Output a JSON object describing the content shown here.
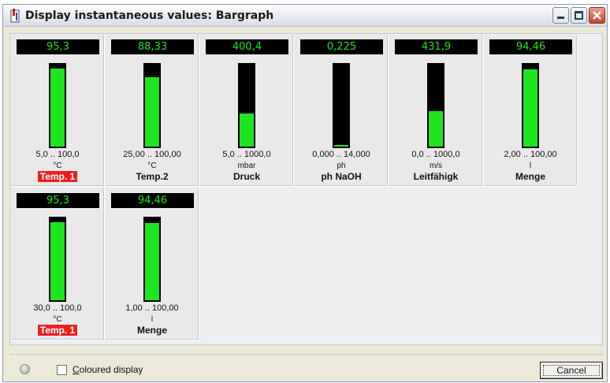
{
  "window": {
    "title": "Display instantaneous values: Bargraph"
  },
  "channels": [
    {
      "value": "95,3",
      "range": "5,0 .. 100,0",
      "unit": "°C",
      "name": "Temp. 1",
      "alarm": true,
      "level": 0.95
    },
    {
      "value": "88,33",
      "range": "25,00 .. 100,00",
      "unit": "°C",
      "name": "Temp.2",
      "alarm": false,
      "level": 0.85
    },
    {
      "value": "400,4",
      "range": "5,0 .. 1000,0",
      "unit": "mbar",
      "name": "Druck",
      "alarm": false,
      "level": 0.4
    },
    {
      "value": "0,225",
      "range": "0,000 .. 14,000",
      "unit": "ph",
      "name": "ph NaOH",
      "alarm": false,
      "level": 0.02
    },
    {
      "value": "431,9",
      "range": "0,0 .. 1000,0",
      "unit": "m/s",
      "name": "Leitfähigk",
      "alarm": false,
      "level": 0.43
    },
    {
      "value": "94,46",
      "range": "2,00 .. 100,00",
      "unit": "l",
      "name": "Menge",
      "alarm": false,
      "level": 0.94
    },
    {
      "value": "95,3",
      "range": "30,0 .. 100,0",
      "unit": "°C",
      "name": "Temp. 1",
      "alarm": true,
      "level": 0.95
    },
    {
      "value": "94,46",
      "range": "1,00 .. 100,00",
      "unit": "l",
      "name": "Menge",
      "alarm": false,
      "level": 0.94
    }
  ],
  "footer": {
    "checkbox_label_underlined": "C",
    "checkbox_label_rest": "oloured display",
    "checkbox_checked": false,
    "cancel_label": "Cancel"
  },
  "colors": {
    "bar_fill": "#1ee61e",
    "value_text": "#25e01c",
    "alarm_bg": "#ec1f1f"
  }
}
